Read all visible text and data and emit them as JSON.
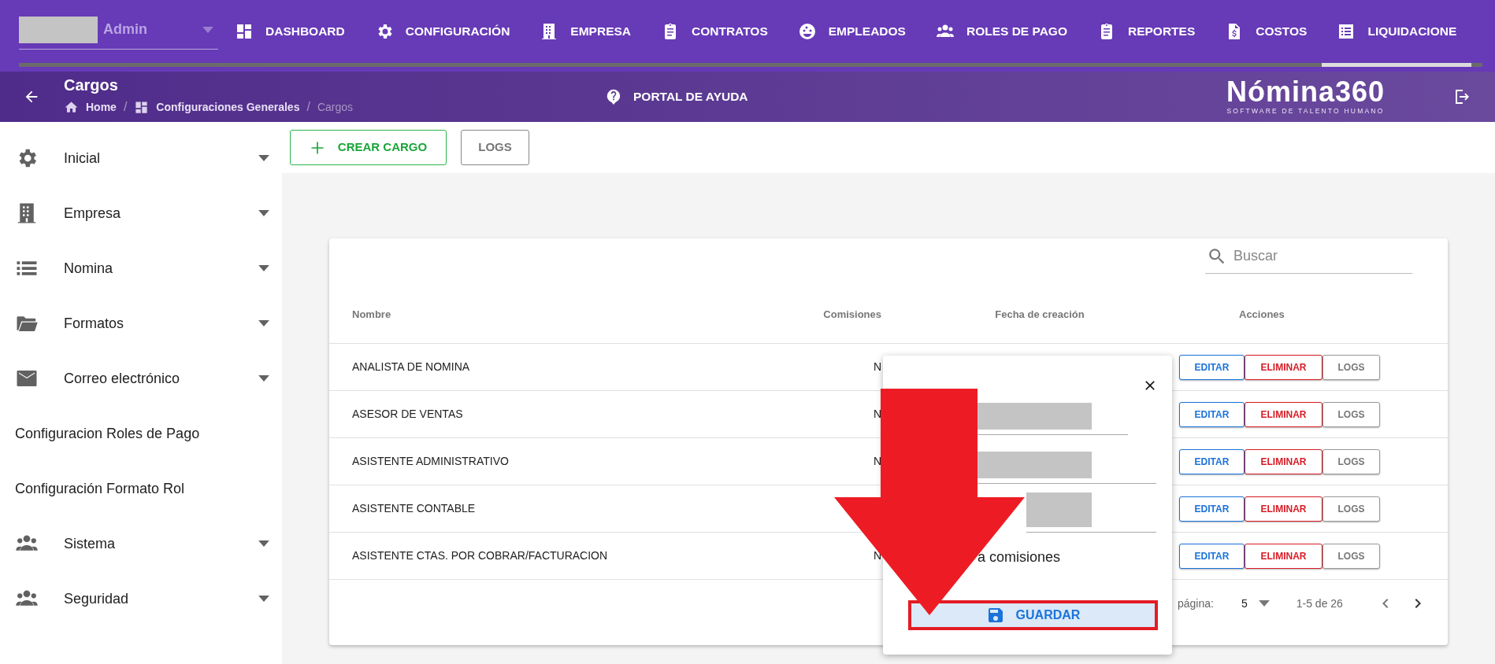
{
  "top_nav": {
    "user_field": {
      "value": "Admin",
      "redacted": true
    },
    "items": [
      {
        "label": "DASHBOARD",
        "selected": false
      },
      {
        "label": "CONFIGURACIÓN",
        "selected": false
      },
      {
        "label": "EMPRESA",
        "selected": false
      },
      {
        "label": "CONTRATOS",
        "selected": false
      },
      {
        "label": "EMPLEADOS",
        "selected": false
      },
      {
        "label": "ROLES DE PAGO",
        "selected": false
      },
      {
        "label": "REPORTES",
        "selected": false
      },
      {
        "label": "COSTOS",
        "selected": false
      },
      {
        "label": "LIQUIDACIONE",
        "selected": true
      }
    ]
  },
  "header": {
    "title": "Cargos",
    "breadcrumb": [
      {
        "label": "Home",
        "current": false
      },
      {
        "label": "Configuraciones Generales",
        "current": false
      },
      {
        "label": "Cargos",
        "current": true
      }
    ],
    "separator": "/",
    "help": "PORTAL DE AYUDA",
    "logo": {
      "name": "Nómina360",
      "tagline": "SOFTWARE DE TALENTO HUMANO"
    }
  },
  "sidebar": {
    "items": [
      {
        "label": "Inicial",
        "kind": "group",
        "expanded": false
      },
      {
        "label": "Empresa",
        "kind": "group",
        "expanded": false
      },
      {
        "label": "Nomina",
        "kind": "group",
        "expanded": false
      },
      {
        "label": "Formatos",
        "kind": "group",
        "expanded": false
      },
      {
        "label": "Correo electrónico",
        "kind": "group",
        "expanded": false
      },
      {
        "label": "Configuracion Roles de Pago",
        "kind": "link"
      },
      {
        "label": "Configuración Formato Rol",
        "kind": "link"
      },
      {
        "label": "Sistema",
        "kind": "group",
        "expanded": false
      },
      {
        "label": "Seguridad",
        "kind": "group",
        "expanded": false
      }
    ]
  },
  "toolbar": {
    "buttons": [
      {
        "label": "CREAR CARGO",
        "kind": "create"
      },
      {
        "label": "LOGS",
        "kind": "logs"
      }
    ]
  },
  "table": {
    "search": {
      "placeholder": "Buscar"
    },
    "columns": [
      "Nombre",
      "Comisiones",
      "Fecha de creación",
      "Acciones"
    ],
    "rows": [
      {
        "nombre": "ANALISTA DE NOMINA",
        "comisiones": "N",
        "actions": [
          {
            "label": "EDITAR",
            "kind": "edit"
          },
          {
            "label": "ELIMINAR",
            "kind": "delete"
          },
          {
            "label": "LOGS",
            "kind": "logs"
          }
        ]
      },
      {
        "nombre": "ASESOR DE VENTAS",
        "comisiones": "N",
        "actions": [
          {
            "label": "EDITAR",
            "kind": "edit"
          },
          {
            "label": "ELIMINAR",
            "kind": "delete"
          },
          {
            "label": "LOGS",
            "kind": "logs"
          }
        ]
      },
      {
        "nombre": "ASISTENTE ADMINISTRATIVO",
        "comisiones": "N",
        "actions": [
          {
            "label": "EDITAR",
            "kind": "edit"
          },
          {
            "label": "ELIMINAR",
            "kind": "delete"
          },
          {
            "label": "LOGS",
            "kind": "logs"
          }
        ]
      },
      {
        "nombre": "ASISTENTE CONTABLE",
        "actions": [
          {
            "label": "EDITAR",
            "kind": "edit"
          },
          {
            "label": "ELIMINAR",
            "kind": "delete"
          },
          {
            "label": "LOGS",
            "kind": "logs"
          }
        ]
      },
      {
        "nombre": "ASISTENTE CTAS. POR COBRAR/FACTURACION",
        "comisiones": "N",
        "actions": [
          {
            "label": "EDITAR",
            "kind": "edit"
          },
          {
            "label": "ELIMINAR",
            "kind": "delete"
          },
          {
            "label": "LOGS",
            "kind": "logs"
          }
        ]
      }
    ],
    "pagination": {
      "label": "página:",
      "per_page": "5",
      "range": "1-5 de 26"
    }
  },
  "dialog": {
    "fields": [
      {
        "redacted": true
      },
      {
        "redacted": true
      },
      {
        "redacted": true
      }
    ],
    "text": "a comisiones",
    "button": "GUARDAR",
    "highlighted": true
  }
}
